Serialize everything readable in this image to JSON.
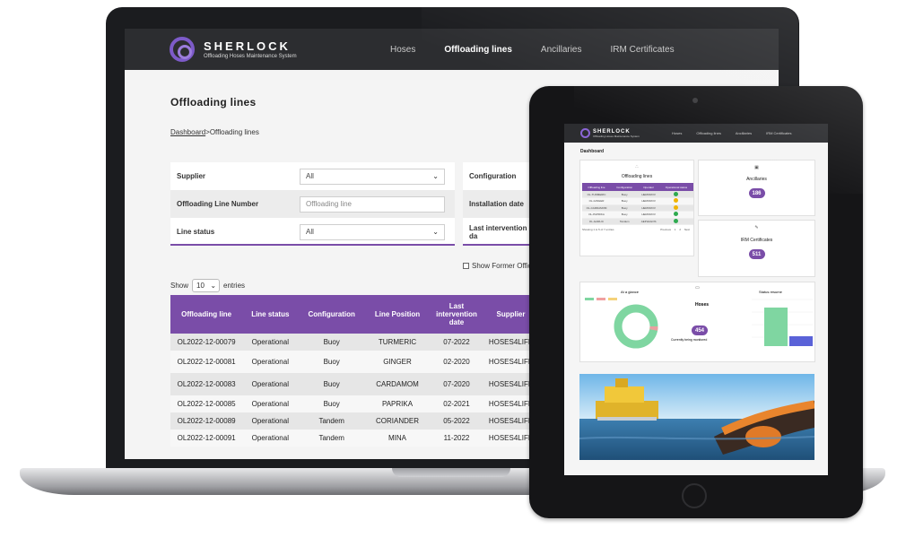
{
  "laptop": {
    "app": {
      "brand": "SHERLOCK",
      "tagline": "Offloading Hoses Maintenance System"
    },
    "nav": [
      {
        "label": "Hoses",
        "active": false
      },
      {
        "label": "Offloading lines",
        "active": true
      },
      {
        "label": "Ancillaries",
        "active": false
      },
      {
        "label": "IRM Certificates",
        "active": false
      }
    ],
    "page_title": "Offloading lines",
    "breadcrumb": {
      "link": "Dashboard",
      "current": ">Offloading lines"
    },
    "filters_left": [
      {
        "label": "Supplier",
        "value": "All",
        "type": "select"
      },
      {
        "label": "Offloading Line Number",
        "value": "Offloading line",
        "type": "input-placeholder"
      },
      {
        "label": "Line status",
        "value": "All",
        "type": "select"
      }
    ],
    "filters_right": [
      {
        "label": "Configuration"
      },
      {
        "label": "Installation date"
      },
      {
        "label": "Last intervention da"
      }
    ],
    "former_checkbox_label": "Show Former Offic",
    "show_entries": {
      "prefix": "Show",
      "value": "10",
      "suffix": "entries"
    },
    "table": {
      "headers": [
        "Offloading line",
        "Line status",
        "Configuration",
        "Line Position",
        "Last intervention date",
        "Supplier"
      ],
      "rows": [
        [
          "OL2022-12-00079",
          "Operational",
          "Buoy",
          "TURMERIC",
          "07-2022",
          "HOSES4LIFE"
        ],
        [
          "OL2022-12-00081",
          "Operational",
          "Buoy",
          "GINGER",
          "02-2020",
          "HOSES4LIFE"
        ],
        [
          "OL2022-12-00083",
          "Operational",
          "Buoy",
          "CARDAMOM",
          "07-2020",
          "HOSES4LIFE"
        ],
        [
          "OL2022-12-00085",
          "Operational",
          "Buoy",
          "PAPRIKA",
          "02-2021",
          "HOSES4LIFE"
        ],
        [
          "OL2022-12-00089",
          "Operational",
          "Tandem",
          "CORIANDER",
          "05-2022",
          "HOSES4LIFE"
        ],
        [
          "OL2022-12-00091",
          "Operational",
          "Tandem",
          "MINA",
          "11-2022",
          "HOSES4LIFE"
        ]
      ]
    }
  },
  "tablet": {
    "app": {
      "brand": "SHERLOCK",
      "tagline": "Offloading Hoses Maintenance System"
    },
    "nav": [
      "Hoses",
      "Offloading lines",
      "Ancillaries",
      "IRM Certificates"
    ],
    "page_title": "Dashboard",
    "offloading_card": {
      "title": "Offloading lines",
      "headers": [
        "Offloading line",
        "Configuration",
        "Operator",
        "Operational status"
      ],
      "rows": [
        {
          "id": "OL-TURMERIC",
          "conf": "Buoy",
          "op": "HEMOROV",
          "status_color": "#2eaa4f"
        },
        {
          "id": "OL-GINGER",
          "conf": "Buoy",
          "op": "HEMOROV",
          "status_color": "#f0b400"
        },
        {
          "id": "OL-CARDAMOM",
          "conf": "Buoy",
          "op": "HEMOROV",
          "status_color": "#f0b400"
        },
        {
          "id": "OL-PAPRIKA",
          "conf": "Buoy",
          "op": "HEMOROV",
          "status_color": "#2eaa4f"
        },
        {
          "id": "OL-GARLIC",
          "conf": "Tandem",
          "op": "AEPHAGOS",
          "status_color": "#2eaa4f"
        }
      ],
      "footer": "Showing 1 to 5 of 7 entries",
      "pager": [
        "Previous",
        "1",
        "2",
        "Next"
      ]
    },
    "ancillaries_card": {
      "title": "Ancillaries",
      "count": "186"
    },
    "irm_card": {
      "title": "IRM Certificates",
      "count": "511"
    },
    "glance_card": {
      "title": "At a glance",
      "hoses_title": "Hoses",
      "hoses_count": "454",
      "hoses_caption": "Currently being monitored",
      "status_title": "Status resume",
      "accent_green": "#7fd6a1",
      "accent_blue": "#5a62d8"
    }
  }
}
